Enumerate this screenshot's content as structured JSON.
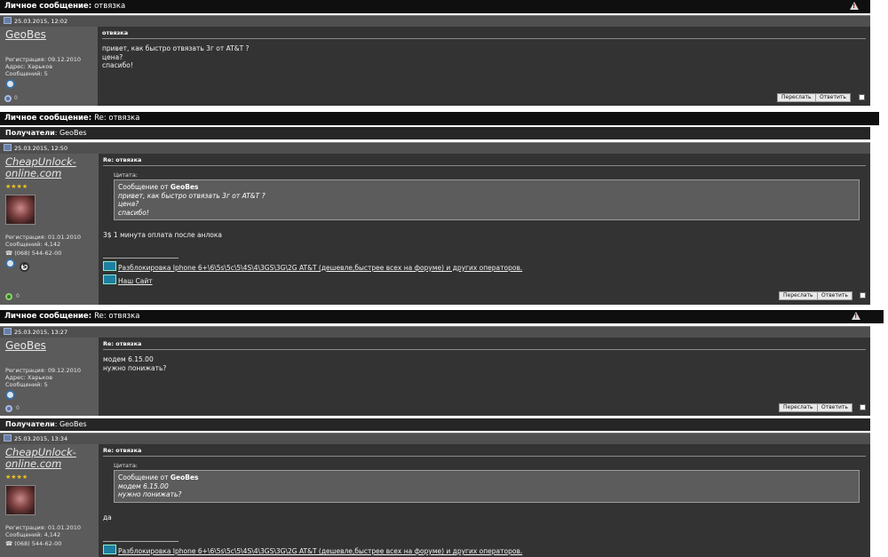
{
  "post1": {
    "title": "Личное сообщение",
    "subject": "отвязка",
    "date": "25.03.2015, 12:02",
    "user": {
      "name": "GeoBes",
      "reg": "Регистрация: 09.12.2010",
      "addr": "Адрес: Харьков",
      "posts": "Сообщений: 5"
    },
    "msg_subject": "отвязка",
    "lines": [
      "привет, как быстро отвязать 3г от AT&T ?",
      "цена?",
      "спасибо!"
    ],
    "forward": "Переслать",
    "reply": "Ответить",
    "offline_count": "0"
  },
  "post2": {
    "title": "Личное сообщение",
    "subject": "Re: отвязка",
    "recipients_label": "Получатели",
    "recipients": "GeoBes",
    "date": "25.03.2015, 12:50",
    "user": {
      "name_line1": "CheapUnlock-",
      "name_line2": "online.com",
      "stars": "★★★★",
      "reg": "Регистрация: 01.01.2010",
      "posts": "Сообщений: 4,142",
      "phone": "(068) 544-62-00"
    },
    "msg_subject": "Re: отвязка",
    "quote_label": "Цитата:",
    "quote_from": "Сообщение от",
    "quote_author": "GeoBes",
    "quote_lines": [
      "привет, как быстро отвязать 3г от AT&T ?",
      "цена?",
      "спасибо!"
    ],
    "body": "3$ 1 минута оплата после анлока",
    "sig_link1": "Разблокировка Iphone 6+\\6\\5s\\5c\\5\\4S\\4\\3GS\\3G\\2G AT&T (дешевле,быстрее всех на форуме) и других операторов.",
    "sig_link2": "Наш Сайт",
    "forward": "Переслать",
    "reply": "Ответить",
    "online_count": "0"
  },
  "post3": {
    "title": "Личное сообщение",
    "subject": "Re: отвязка",
    "date": "25.03.2015, 13:27",
    "user": {
      "name": "GeoBes",
      "reg": "Регистрация: 09.12.2010",
      "addr": "Адрес: Харьков",
      "posts": "Сообщений: 5"
    },
    "msg_subject": "Re: отвязка",
    "lines": [
      "модем 6.15.00",
      "нужно понижать?"
    ],
    "forward": "Переслать",
    "reply": "Ответить",
    "offline_count": "0"
  },
  "post4": {
    "recipients_label": "Получатели",
    "recipients": "GeoBes",
    "date": "25.03.2015, 13:34",
    "user": {
      "name_line1": "CheapUnlock-",
      "name_line2": "online.com",
      "stars": "★★★★",
      "reg": "Регистрация: 01.01.2010",
      "posts": "Сообщений: 4,142",
      "phone": "(068) 544-62-00"
    },
    "msg_subject": "Re: отвязка",
    "quote_label": "Цитата:",
    "quote_from": "Сообщение от",
    "quote_author": "GeoBes",
    "quote_lines": [
      "модем 6.15.00",
      "нужно понижать?"
    ],
    "body": "да",
    "sig_link1": "Разблокировка Iphone 6+\\6\\5s\\5c\\5\\4S\\4\\3GS\\3G\\2G AT&T (дешевле,быстрее всех на форуме) и других операторов."
  },
  "icons": {
    "warning": "warning-icon",
    "date": "post-doc-icon",
    "quote": "multiquote-icon",
    "status": "online-status-icon"
  },
  "colors": {
    "title_bg": "#0f0f0f",
    "date_bg": "#4f4f4f",
    "user_bg": "#5b5b5b",
    "msg_bg": "#333333",
    "stars": "#f3c41a"
  }
}
